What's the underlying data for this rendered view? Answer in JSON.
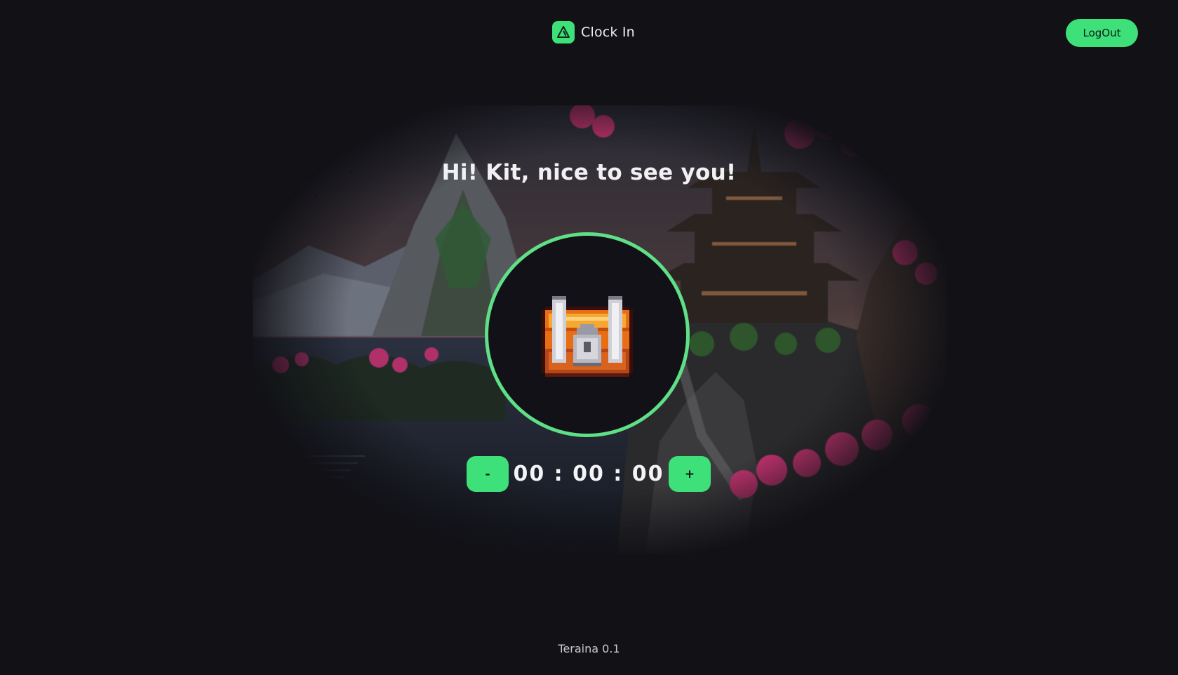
{
  "header": {
    "brand_name": "Clock In",
    "logo_icon": "triangle-logo-icon",
    "logout_label": "LogOut"
  },
  "main": {
    "greeting": "Hi! Kit, nice to see you!",
    "chest_icon": "treasure-chest-icon",
    "decrease_label": "-",
    "increase_label": "+",
    "timer": "00 : 00 : 00"
  },
  "footer": {
    "version": "Teraina 0.1"
  },
  "colors": {
    "accent": "#3ee07a",
    "ring": "#5fdf86",
    "background": "#111116"
  }
}
